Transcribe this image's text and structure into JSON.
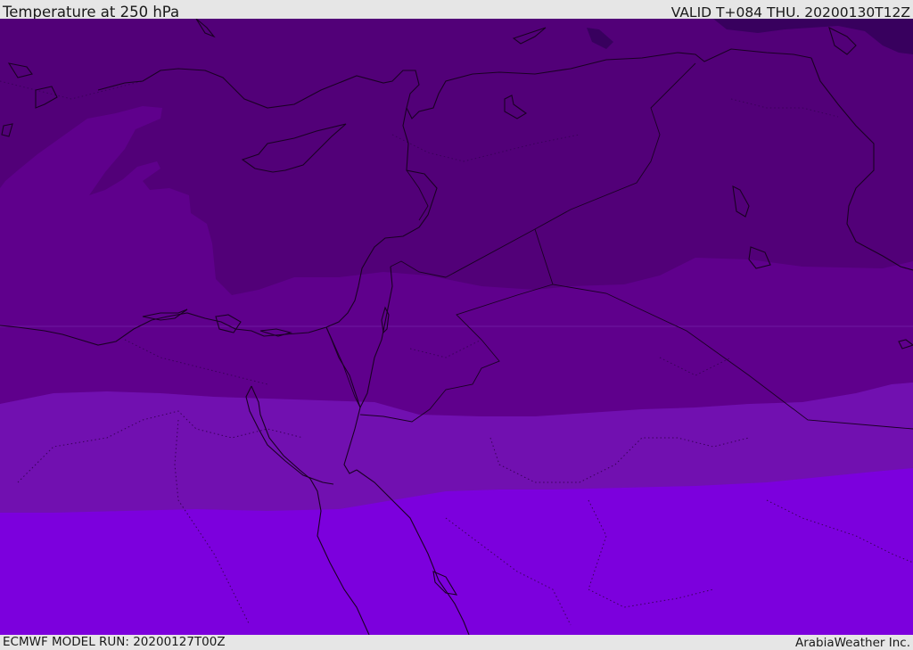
{
  "header": {
    "title": "Temperature at 250 hPa",
    "valid_time": "VALID T+084 THU. 20200130T12Z"
  },
  "footer": {
    "model_run": "ECMWF MODEL RUN: 20200127T00Z",
    "credit": "ArabiaWeather Inc."
  },
  "map": {
    "field": "temperature",
    "level": "250 hPa",
    "region": "Eastern Mediterranean / Middle East",
    "palette": {
      "band_darkest": "#38005e",
      "band_1": "#520078",
      "band_2": "#5f008c",
      "band_3": "#7110b0",
      "band_4": "#7c00dd",
      "coastline": "#1a0024"
    }
  }
}
